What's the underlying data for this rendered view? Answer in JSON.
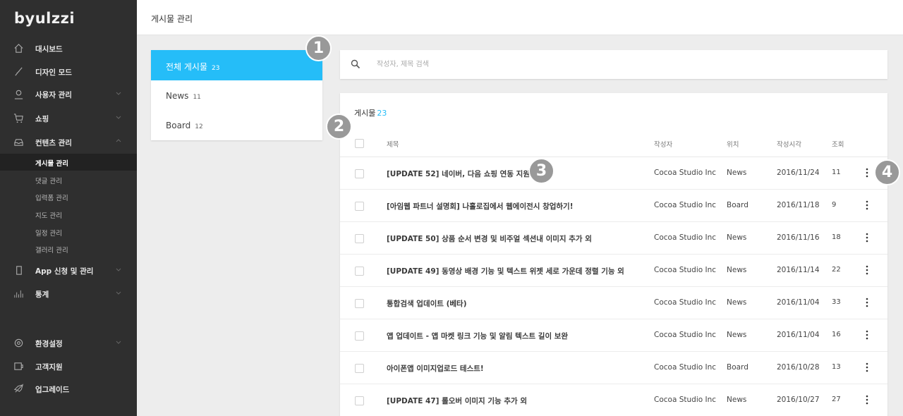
{
  "logo": "byulzzi",
  "sidebar": {
    "items": [
      {
        "label": "대시보드",
        "icon": "home-icon"
      },
      {
        "label": "디자인 모드",
        "icon": "brush-icon"
      },
      {
        "label": "사용자 관리",
        "icon": "user-icon"
      },
      {
        "label": "쇼핑",
        "icon": "cart-icon"
      },
      {
        "label": "컨텐츠 관리",
        "icon": "inbox-icon"
      }
    ],
    "sub_items": [
      "게시물 관리",
      "댓글 관리",
      "입력폼 관리",
      "지도 관리",
      "일정 관리",
      "갤러리 관리"
    ],
    "items2": [
      {
        "label": "App 신청 및 관리",
        "icon": "mobile-icon"
      },
      {
        "label": "통계",
        "icon": "chart-icon"
      }
    ],
    "bottom_items": [
      {
        "label": "환경설정",
        "icon": "settings-icon"
      },
      {
        "label": "고객지원",
        "icon": "support-icon"
      },
      {
        "label": "업그레이드",
        "icon": "rocket-icon"
      }
    ]
  },
  "header": {
    "title": "게시물 관리"
  },
  "categories": [
    {
      "label": "전체 게시물",
      "count": "23"
    },
    {
      "label": "News",
      "count": "11"
    },
    {
      "label": "Board",
      "count": "12"
    }
  ],
  "search": {
    "placeholder": "작성자, 제목 검색"
  },
  "posts": {
    "title": "게시물",
    "count": "23",
    "columns": {
      "title": "제목",
      "author": "작성자",
      "location": "위치",
      "date": "작성시각",
      "views": "조회"
    },
    "rows": [
      {
        "title": "[UPDATE 52] 네이버, 다음 쇼핑 연동 지원",
        "author": "Cocoa Studio Inc",
        "location": "News",
        "date": "2016/11/24",
        "views": "11"
      },
      {
        "title": "[아임웹 파트너 설명회] 나홀로집에서 웹에이전시 창업하기!",
        "author": "Cocoa Studio Inc",
        "location": "Board",
        "date": "2016/11/18",
        "views": "9"
      },
      {
        "title": "[UPDATE 50] 상품 순서 변경 및 비주얼 섹션내 이미지 추가 외",
        "author": "Cocoa Studio Inc",
        "location": "News",
        "date": "2016/11/16",
        "views": "18"
      },
      {
        "title": "[UPDATE 49] 동영상 배경 기능 및 텍스트 위젯 세로 가운데 정렬 기능 외",
        "author": "Cocoa Studio Inc",
        "location": "News",
        "date": "2016/11/14",
        "views": "22"
      },
      {
        "title": "통합검색 업데이트 (베타)",
        "author": "Cocoa Studio Inc",
        "location": "News",
        "date": "2016/11/04",
        "views": "33"
      },
      {
        "title": "앱 업데이트 - 앱 마켓 링크 기능 및 알림 텍스트 길이 보완",
        "author": "Cocoa Studio Inc",
        "location": "News",
        "date": "2016/11/04",
        "views": "16"
      },
      {
        "title": "아이폰앱 이미지업로드 테스트!",
        "author": "Cocoa Studio Inc",
        "location": "Board",
        "date": "2016/10/28",
        "views": "13"
      },
      {
        "title": "[UPDATE 47] 롤오버 이미지 기능 추가 외",
        "author": "Cocoa Studio Inc",
        "location": "News",
        "date": "2016/10/27",
        "views": "27"
      }
    ]
  },
  "badges": [
    "1",
    "2",
    "3",
    "4"
  ],
  "colors": {
    "accent": "#25bdf8",
    "sidebar_bg": "#2f2f2f",
    "badge": "#999999"
  }
}
